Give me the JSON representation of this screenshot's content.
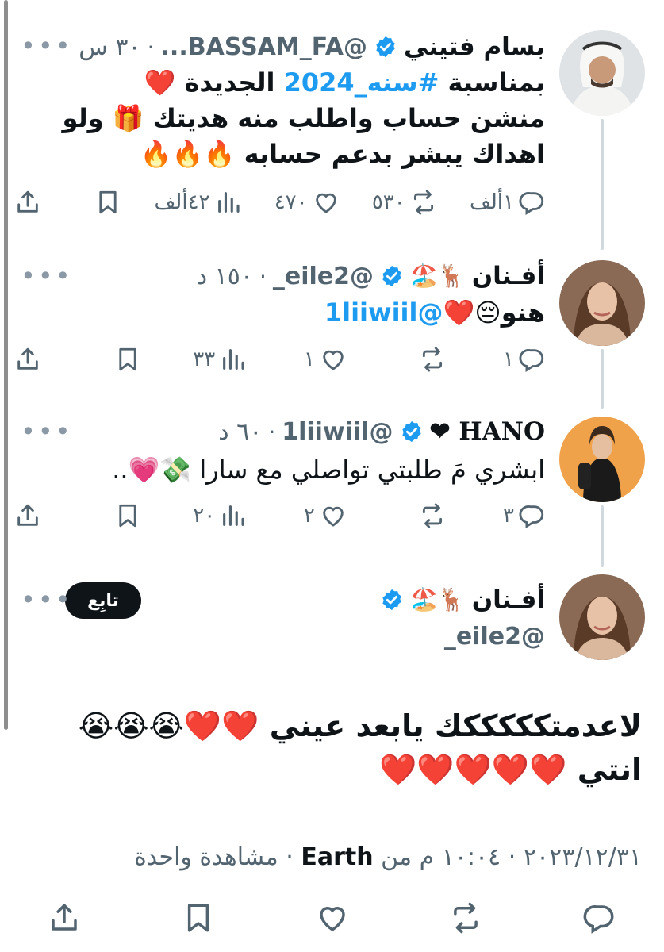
{
  "posts": [
    {
      "name": "بسام فتيني",
      "badges": "",
      "handle": "@BASSAM_FA...",
      "time": "٣٠ س",
      "lines": [
        {
          "text": "بمناسبة ",
          "link": "#سنه_2024",
          "after": " الجديدة ❤️"
        },
        {
          "text": "منشن حساب واطلب منه هديتك 🎁 ولو",
          "link": "",
          "after": ""
        },
        {
          "text": "اهداك يبشر بدعم حسابه 🔥🔥🔥",
          "link": "",
          "after": ""
        }
      ],
      "actions": {
        "reply": "١ألف",
        "repost": "٥٣٠",
        "like": "٤٧٠",
        "views": "٤٢ألف"
      }
    },
    {
      "name": "أفـنان",
      "badges": "🦌🏖️",
      "handle": "@eile2_",
      "time": "١٥٠ د",
      "lines": [
        {
          "text": "هنو😔❤️",
          "link": "@1liiwiil",
          "after": ""
        }
      ],
      "actions": {
        "reply": "١",
        "repost": "",
        "like": "١",
        "views": "٣٣"
      }
    },
    {
      "name": "HANO ❤",
      "badges": "",
      "handle": "@1liiwiil",
      "time": "٦٠ د",
      "lines": [
        {
          "text": "ابشري مَ طلبتي تواصلي مع سارا 💸💗..",
          "link": "",
          "after": ""
        }
      ],
      "actions": {
        "reply": "٣",
        "repost": "",
        "like": "٢",
        "views": "٢٠"
      }
    }
  ],
  "main_post": {
    "name": "أفـنان",
    "badges": "🦌🏖️",
    "handle": "@eile2_",
    "follow_label": "تابِع",
    "text_line1": "لاعدمتكككككك يابعد عيني ❤️❤️😭😭😭",
    "text_line2": "انتي ❤️❤️❤️❤️❤️",
    "meta_time": "١٠:٠٤ م",
    "meta_date": "٢٠٢٣/١٢/٣١",
    "meta_from": "من",
    "meta_source": "Earth",
    "meta_views": "مشاهدة واحدة"
  },
  "icons": {
    "reply": "reply-icon",
    "repost": "repost-icon",
    "like": "like-icon",
    "views": "views-icon",
    "bookmark": "bookmark-icon",
    "share": "share-icon",
    "verified": "verified-badge-icon",
    "more": "more-icon"
  },
  "colors": {
    "link": "#1d9bf0",
    "verified": "#1d9bf0",
    "follow_bg": "#0f1419",
    "muted": "#536471"
  },
  "more_label": "•••"
}
